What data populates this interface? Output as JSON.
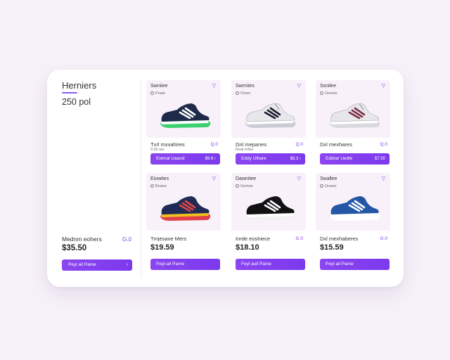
{
  "sidebar": {
    "brand": "Herniers",
    "count": "250 pol",
    "featured": {
      "name": "Mednm eohers",
      "icon_text": "G.0",
      "price": "$35.50",
      "button": "Peyl ail Pame"
    }
  },
  "products": [
    {
      "title": "Swniiee",
      "sub": "Poaie",
      "name": "Tvrl mxxahires",
      "stock": "0.00 ser",
      "icon_text": "Q.0",
      "button": "Ewmal Uaand",
      "button_right": "$9.9 ›",
      "price": "",
      "colors": {
        "upper": "#1f2a4a",
        "accent": "#ffffff",
        "sole": "#3bd16f",
        "base": "#ffffff"
      }
    },
    {
      "title": "Swrnites",
      "sub": "Cinee",
      "name": "Dnl mepanes",
      "stock": "Reat hrlbs",
      "icon_text": "Q.0",
      "button": "Eddy Ulhare",
      "button_right": "$8.3 ›",
      "price": "",
      "colors": {
        "upper": "#e8e8ec",
        "accent": "#1a1a2e",
        "sole": "#c9ccd6",
        "base": "#ffffff"
      }
    },
    {
      "title": "Sxnilee",
      "sub": "Gxmee",
      "name": "Dxl mexhares",
      "stock": "",
      "icon_text": "Q.0",
      "button": "Eddrar Uedle",
      "button_right": "$7.50",
      "price": "",
      "colors": {
        "upper": "#e7e6ea",
        "accent": "#7a2f45",
        "sole": "#d8d8de",
        "base": "#ffffff"
      }
    },
    {
      "title": "Eiowites",
      "sub": "Boaoe",
      "name": "Tmjesaxe Mers",
      "stock": "",
      "icon_text": "",
      "button": "Peyl-ail Pame",
      "button_right": "",
      "price": "$19.59",
      "colors": {
        "upper": "#1f2b55",
        "accent": "#e04848",
        "sole": "#e0404a",
        "base": "#f0c020"
      }
    },
    {
      "title": "Dawnitee",
      "sub": "Gxmee",
      "name": "Inrde eoshiece",
      "stock": "",
      "icon_text": "G.0",
      "button": "Feyl aull Pame",
      "button_right": "",
      "price": "$18.10",
      "colors": {
        "upper": "#111114",
        "accent": "#ffffff",
        "sole": "#f2f2f2",
        "base": "#ffffff"
      }
    },
    {
      "title": "Swallee",
      "sub": "Goaee",
      "name": "Dxl mexhaberes",
      "stock": "",
      "icon_text": "G.0",
      "button": "Peyl ail Pame",
      "button_right": "",
      "price": "$15.59",
      "colors": {
        "upper": "#2457a6",
        "accent": "#ffffff",
        "sole": "#ffffff",
        "base": "#ffffff"
      }
    }
  ]
}
